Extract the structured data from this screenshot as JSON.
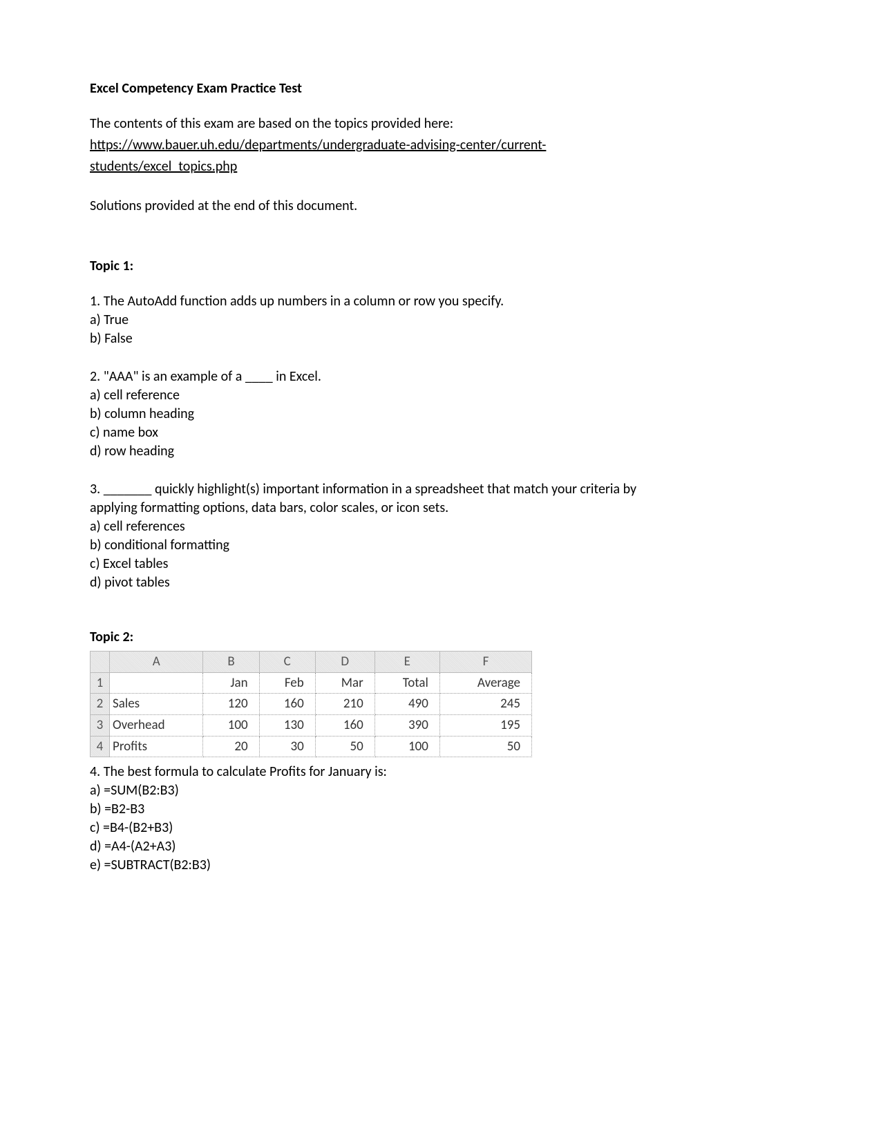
{
  "title": "Excel Competency Exam Practice Test",
  "intro_line": "The contents of this exam are based on the topics provided here:",
  "link_line1": "https://www.bauer.uh.edu/departments/undergraduate-advising-center/current-",
  "link_line2": "students/excel_topics.php",
  "solutions_note": "Solutions provided at the end of this document.",
  "topic1": {
    "heading": "Topic 1:",
    "q1": {
      "text": "1. The AutoAdd function adds up numbers in a column or row you specify.",
      "a": "a) True",
      "b": "b) False"
    },
    "q2": {
      "text": "2. \"AAA\" is an example of a ____ in Excel.",
      "a": "a) cell reference",
      "b": "b) column heading",
      "c": "c) name box",
      "d": "d) row heading"
    },
    "q3": {
      "line1": "3. _______ quickly highlight(s) important information in a spreadsheet that match your criteria by",
      "line2": "applying formatting options, data bars, color scales, or icon sets.",
      "a": "a) cell references",
      "b": "b) conditional formatting",
      "c": "c) Excel tables",
      "d": "d) pivot tables"
    }
  },
  "topic2": {
    "heading": "Topic 2:",
    "table": {
      "cols": [
        "A",
        "B",
        "C",
        "D",
        "E",
        "F"
      ],
      "row_nums": [
        "1",
        "2",
        "3",
        "4"
      ],
      "header_row": [
        "",
        "Jan",
        "Feb",
        "Mar",
        "Total",
        "Average"
      ],
      "rows": [
        [
          "Sales",
          "120",
          "160",
          "210",
          "490",
          "245"
        ],
        [
          "Overhead",
          "100",
          "130",
          "160",
          "390",
          "195"
        ],
        [
          "Profits",
          "20",
          "30",
          "50",
          "100",
          "50"
        ]
      ]
    },
    "q4": {
      "text": "4. The best formula to calculate Profits for January is:",
      "a": "a) =SUM(B2:B3)",
      "b": "b) =B2-B3",
      "c": "c) =B4-(B2+B3)",
      "d": "d) =A4-(A2+A3)",
      "e": "e) =SUBTRACT(B2:B3)"
    }
  }
}
